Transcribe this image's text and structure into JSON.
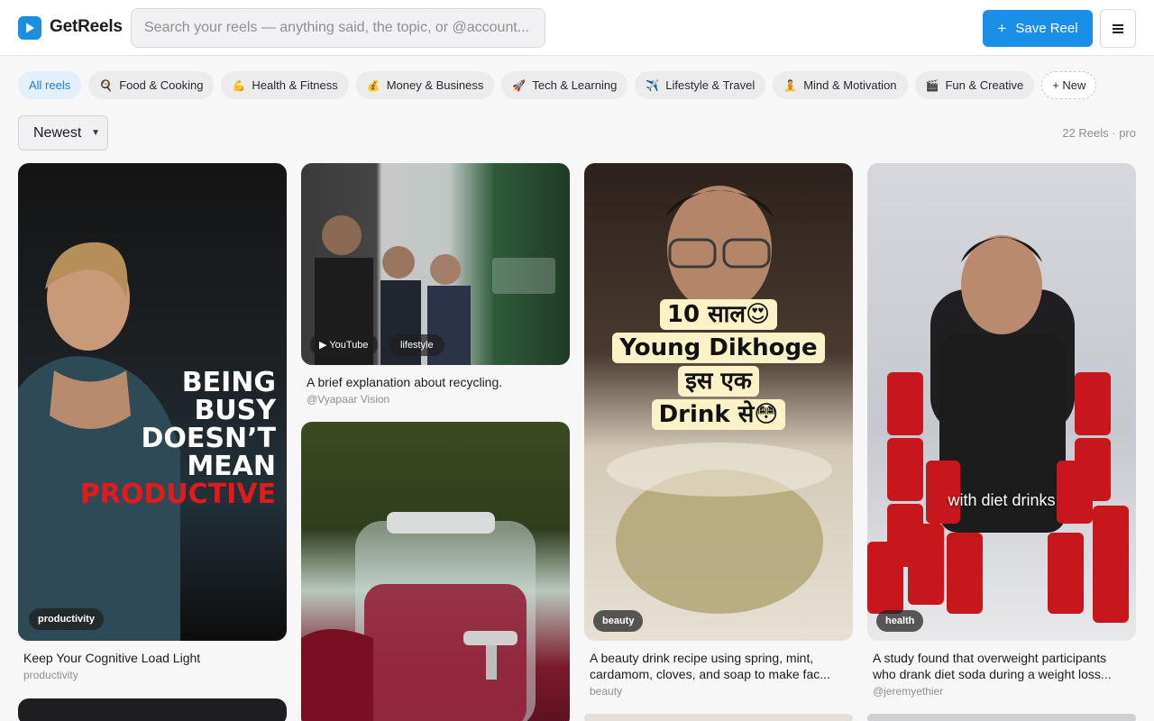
{
  "brand": {
    "name": "GetReels",
    "accent": "#1a8fe8"
  },
  "search": {
    "placeholder": "Search your reels — anything said, the topic, or @account..."
  },
  "toolbar": {
    "save_plus": "+",
    "save_label": "Save Reel"
  },
  "categories": [
    {
      "label": "All reels",
      "icon": ""
    },
    {
      "label": "Food & Cooking",
      "icon": "🍳"
    },
    {
      "label": "Health & Fitness",
      "icon": "💪"
    },
    {
      "label": "Money & Business",
      "icon": "💰"
    },
    {
      "label": "Tech & Learning",
      "icon": "🚀"
    },
    {
      "label": "Lifestyle & Travel",
      "icon": "✈️"
    },
    {
      "label": "Mind & Motivation",
      "icon": "🧘"
    },
    {
      "label": "Fun & Creative",
      "icon": "🎬"
    }
  ],
  "new_chip": {
    "label": "+ New"
  },
  "sort": {
    "selected": "Newest"
  },
  "reel_count": "22 Reels · pro",
  "reels": [
    {
      "overlay_lines": [
        "BEING",
        "BUSY",
        "DOESN’T",
        "MEAN"
      ],
      "overlay_highlight": "PRODUCTIVE",
      "tag": "productivity",
      "title": "Keep Your Cognitive Load Light",
      "subtitle": "productivity"
    },
    {
      "source": "▶ YouTube",
      "tag": "lifestyle",
      "title": "A brief explanation about recycling.",
      "subtitle": "@Vyapaar Vision"
    },
    {
      "overlay_lines": [
        "10 साल😍",
        "Young Dikhoge",
        "इस एक",
        "Drink से😳"
      ],
      "tag": "beauty",
      "title": "A beauty drink recipe using spring, mint, cardamom, cloves, and soap to make fac...",
      "subtitle": "beauty"
    },
    {
      "overlay_text": "with diet drinks",
      "tag": "health",
      "title": "A study found that overweight participants who drank diet soda during a weight loss...",
      "subtitle": "@jeremyethier"
    }
  ]
}
